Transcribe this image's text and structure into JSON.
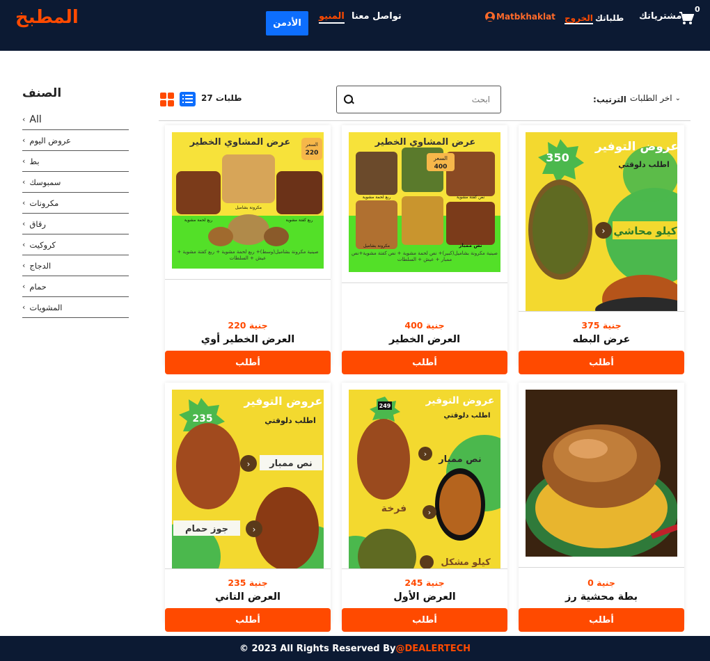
{
  "header": {
    "logo": "المطبخ",
    "admin": "الأدمن",
    "menu": "المنيو",
    "contact": "تواصل معنا",
    "user": "Matbkhaklat",
    "logout": "الخروج",
    "orders": "طلباتك",
    "purchases": "مشترياتك",
    "cart_count": "0",
    "colors": {
      "bg": "#0c1a33",
      "accent": "#ff4a00",
      "admin": "#0d6efd"
    }
  },
  "sidebar": {
    "title": "الصنف",
    "items": [
      "All",
      "عروض اليوم",
      "بط",
      "سمبوسك",
      "مكرونات",
      "رقاق",
      "كروكيت",
      "الدجاج",
      "حمام",
      "المشويات"
    ]
  },
  "toolbar": {
    "count": "27 طلبات",
    "search_placeholder": "ابحث",
    "sort_label": ":الترتيب",
    "sort_value": "اخر الطلبات"
  },
  "products": [
    {
      "name": "عرض البطه",
      "price": "375 جنية",
      "button": "أطلب"
    },
    {
      "name": "العرض الخطير",
      "price": "400 جنية",
      "button": "أطلب"
    },
    {
      "name": "العرض الخطير أوي",
      "price": "220 جنية",
      "button": "أطلب"
    },
    {
      "name": "بطة محشية رز",
      "price": "0 جنية",
      "button": "أطلب"
    },
    {
      "name": "العرض الأول",
      "price": "245 جنية",
      "button": "أطلب"
    },
    {
      "name": "العرض التاني",
      "price": "235 جنية",
      "button": "أطلب"
    }
  ],
  "images": {
    "p1_title": "عروض التوفير",
    "p1_sub": "اطلب دلوقتي",
    "p1_price": "350",
    "p1_tag": "كيلو محاشي",
    "p2_title": "عرض المشاوي الخطير",
    "p2_price_label": "السعر",
    "p2_price": "400",
    "p2_l1": "ربع لحمة مشوية",
    "p2_l2": "نص كفتة مشوية",
    "p2_l3": "مكرونة بشاميل",
    "p2_l4": "نص ممبار",
    "p2_desc": "صينية مكرونة بشاميل(كبير)+ نص لحمة مشوية + نص كفتة مشوية+نص ممبار + عيش + السلطات",
    "p3_title": "عرض المشاوي الخطير",
    "p3_price_label": "السعر",
    "p3_price": "220",
    "p3_l1": "مكرونة بشاميل",
    "p3_l2": "ربع لحمة مشوية",
    "p3_l3": "ربع كفتة مشوية",
    "p3_desc": "صينية مكرونة بشاميل(وسط)+ ربع لحمة مشوية + ربع كفتة مشوية + عيش + السلطات",
    "p5_title": "عروض التوفير",
    "p5_sub": "اطلب دلوقتي",
    "p5_price": "249",
    "p5_t1": "نص ممبار",
    "p5_t2": "فرخة",
    "p5_t3": "كيلو مشكل",
    "p6_title": "عروض التوفير",
    "p6_sub": "اطلب دلوقتي",
    "p6_price": "235",
    "p6_t1": "نص ممبار",
    "p6_t2": "جوز حمام"
  },
  "footer": {
    "text": "© 2023 All Rights Reserved By",
    "brand": "@DEALERTECH"
  }
}
